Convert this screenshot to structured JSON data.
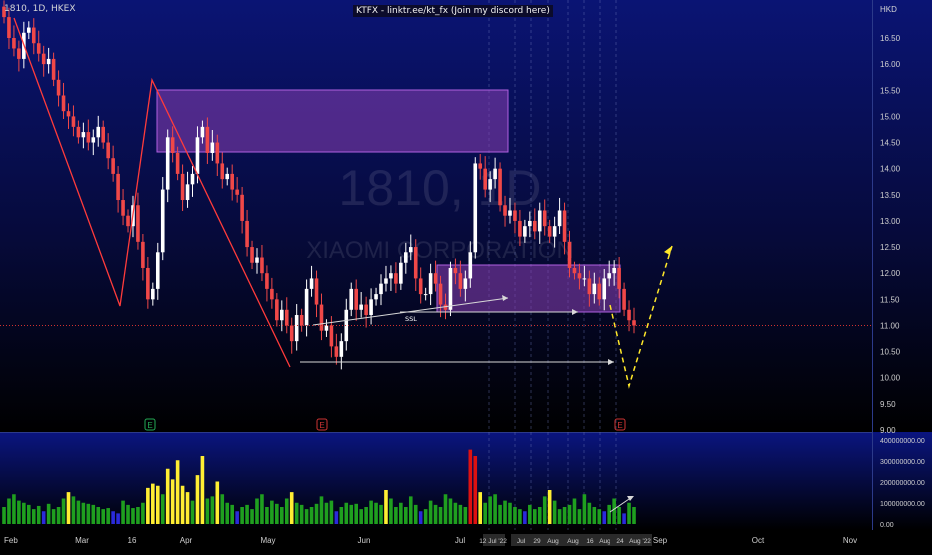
{
  "header": {
    "symbol": "1810, 1D, HKEX",
    "banner": "KTFX - linktr.ee/kt_fx (Join my discord here)",
    "currency": "HKD"
  },
  "watermark": {
    "line1": "1810, 1D",
    "line2": "XIAOMI CORPORATION"
  },
  "colors": {
    "up": "#ffffff",
    "down": "#f04848",
    "vol_green": "#1f9f1f",
    "vol_yellow": "#ffee33",
    "vol_red": "#dd1111",
    "vol_blue": "#2a2adb",
    "zone": "#8a3fb5",
    "pattern": "#ff3b3b",
    "projection": "#ffe82a",
    "price_line": "#d03030"
  },
  "chart_data": {
    "type": "candlestick",
    "price_axis": {
      "min": 9.0,
      "max": 16.5,
      "ticks": [
        "16.50",
        "16.00",
        "15.50",
        "15.00",
        "14.50",
        "14.00",
        "13.50",
        "13.00",
        "12.50",
        "12.00",
        "11.50",
        "11.00",
        "10.50",
        "10.00",
        "9.50",
        "9.00"
      ]
    },
    "volume_axis": {
      "ticks": [
        "400000000.00",
        "300000000.00",
        "200000000.00",
        "100000000.00",
        "0.00"
      ]
    },
    "time_labels": [
      "Feb",
      "Mar",
      "16",
      "Apr",
      "May",
      "Jun",
      "Jul",
      "12 Jul '22",
      "Jul",
      "29",
      "Aug",
      "Aug",
      "16",
      "Aug",
      "24",
      "Aug '22",
      "Sep",
      "Oct",
      "Nov"
    ],
    "current_price": 11.0,
    "closes": [
      16.9,
      16.5,
      16.3,
      16.1,
      16.6,
      16.7,
      16.4,
      16.2,
      16.0,
      16.1,
      15.7,
      15.4,
      15.1,
      15.0,
      14.8,
      14.6,
      14.7,
      14.5,
      14.6,
      14.8,
      14.5,
      14.2,
      13.9,
      13.4,
      13.1,
      12.9,
      13.3,
      12.6,
      12.1,
      11.5,
      11.7,
      12.4,
      13.6,
      14.6,
      14.3,
      13.9,
      13.4,
      13.7,
      13.9,
      14.6,
      14.8,
      14.3,
      14.5,
      14.1,
      13.8,
      13.9,
      13.6,
      13.5,
      13.0,
      12.5,
      12.2,
      12.3,
      12.0,
      11.7,
      11.5,
      11.1,
      11.3,
      11.0,
      10.7,
      11.2,
      11.0,
      11.7,
      11.9,
      11.4,
      10.9,
      11.0,
      10.6,
      10.4,
      10.7,
      11.3,
      11.7,
      11.3,
      11.4,
      11.2,
      11.5,
      11.6,
      11.8,
      11.9,
      12.0,
      11.8,
      12.2,
      12.4,
      12.5,
      11.9,
      11.6,
      11.6,
      12.0,
      11.8,
      11.4,
      11.3,
      12.1,
      12.0,
      11.7,
      11.9,
      12.4,
      14.1,
      14.0,
      13.6,
      13.8,
      14.0,
      13.3,
      13.1,
      13.2,
      13.0,
      12.7,
      12.9,
      13.0,
      12.8,
      13.2,
      12.9,
      12.7,
      12.9,
      13.2,
      12.6,
      12.1,
      12.0,
      11.9,
      11.9,
      11.6,
      11.8,
      11.5,
      11.9,
      12.0,
      12.1,
      11.7,
      11.3,
      11.1,
      11.0
    ],
    "volume": [
      80,
      120,
      140,
      110,
      100,
      90,
      70,
      85,
      60,
      95,
      70,
      80,
      120,
      150,
      130,
      110,
      100,
      95,
      90,
      80,
      70,
      75,
      60,
      50,
      110,
      90,
      75,
      80,
      100,
      170,
      190,
      180,
      140,
      260,
      210,
      300,
      180,
      150,
      110,
      230,
      320,
      120,
      130,
      200,
      140,
      100,
      90,
      60,
      80,
      90,
      70,
      120,
      140,
      80,
      110,
      95,
      80,
      120,
      150,
      100,
      90,
      70,
      80,
      95,
      130,
      100,
      110,
      60,
      80,
      100,
      90,
      95,
      70,
      80,
      110,
      100,
      90,
      160,
      120,
      80,
      100,
      80,
      130,
      90,
      60,
      70,
      110,
      90,
      80,
      140,
      120,
      100,
      90,
      80,
      350,
      320,
      150,
      100,
      130,
      140,
      90,
      110,
      100,
      80,
      70,
      60,
      90,
      70,
      80,
      130,
      160,
      110,
      70,
      80,
      90,
      120,
      70,
      140,
      100,
      80,
      70,
      60,
      90,
      120,
      80,
      50,
      100,
      80
    ]
  },
  "annotations": {
    "ssl": "SSL",
    "event_marks": [
      "E",
      "E",
      "E"
    ]
  }
}
